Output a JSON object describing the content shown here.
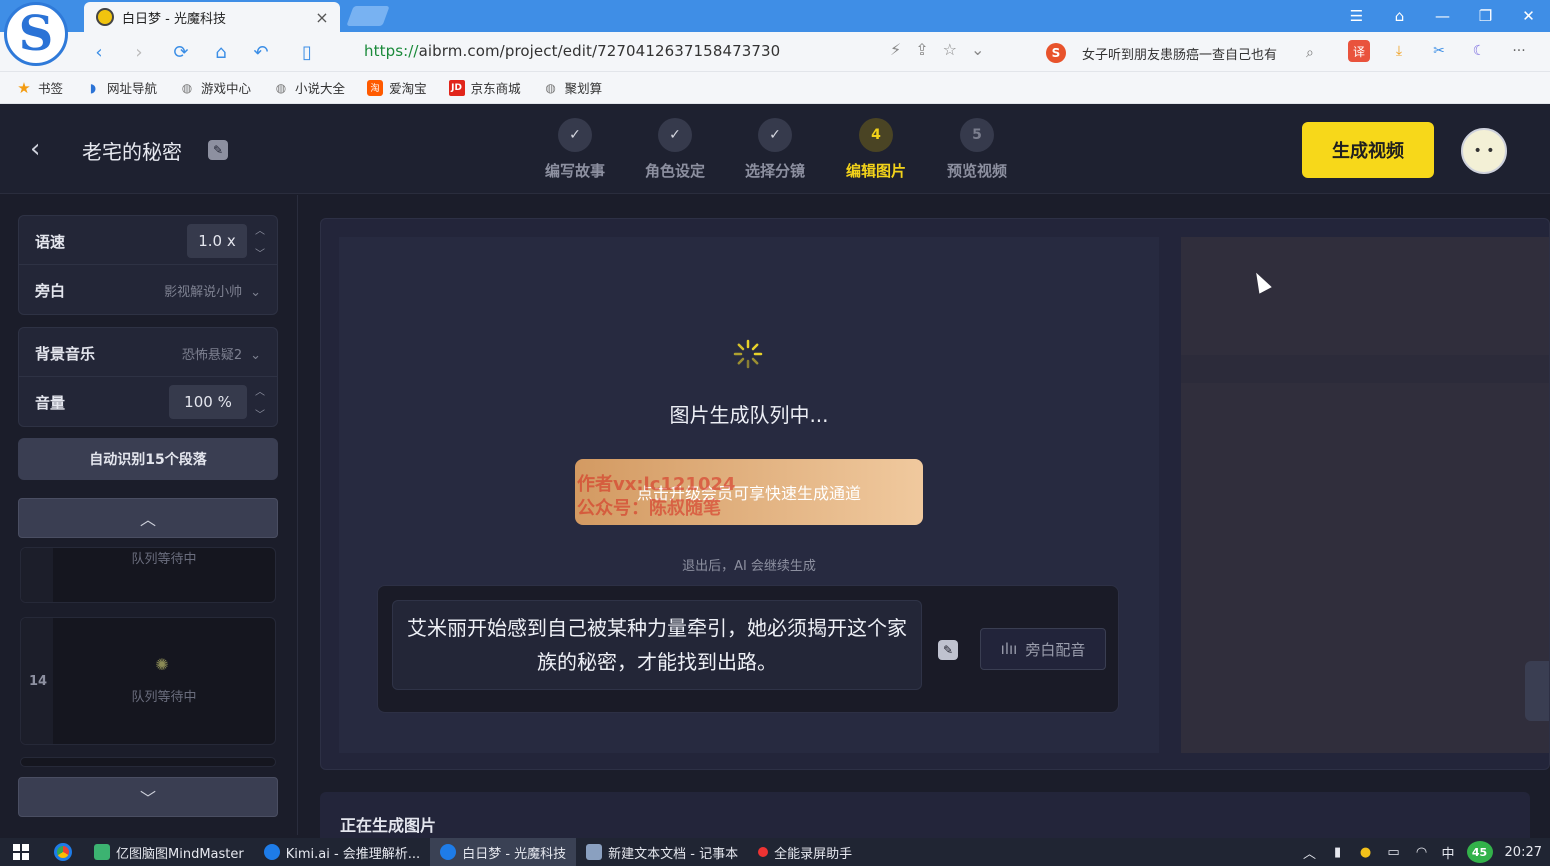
{
  "browser": {
    "tab_title": "白日梦 - 光魔科技",
    "tab_close": "×",
    "url_scheme": "https://",
    "url_rest": "aibrm.com/project/edit/7270412637158473730",
    "search_text": "女子听到朋友患肠癌一查自己也有",
    "search_engine": "S",
    "translate_label": "译",
    "bookmarks": [
      {
        "label": "书签",
        "icon": "star-icon"
      },
      {
        "label": "网址导航",
        "icon": "nav-icon"
      },
      {
        "label": "游戏中心",
        "icon": "globe-icon"
      },
      {
        "label": "小说大全",
        "icon": "globe-icon"
      },
      {
        "label": "爱淘宝",
        "icon": "taobao-icon",
        "badge": "淘"
      },
      {
        "label": "京东商城",
        "icon": "jd-icon",
        "badge": "JD"
      },
      {
        "label": "聚划算",
        "icon": "globe-icon"
      }
    ]
  },
  "header": {
    "project_title": "老宅的秘密",
    "steps": [
      {
        "number": "✓",
        "label": "编写故事",
        "state": "done"
      },
      {
        "number": "✓",
        "label": "角色设定",
        "state": "done"
      },
      {
        "number": "✓",
        "label": "选择分镜",
        "state": "done"
      },
      {
        "number": "4",
        "label": "编辑图片",
        "state": "active"
      },
      {
        "number": "5",
        "label": "预览视频",
        "state": "todo"
      }
    ],
    "generate_button": "生成视频"
  },
  "sidebar": {
    "speed_label": "语速",
    "speed_value": "1.0 x",
    "narration_label": "旁白",
    "narration_value": "影视解说小帅",
    "bgm_label": "背景音乐",
    "bgm_value": "恐怖悬疑2",
    "volume_label": "音量",
    "volume_value": "100 %",
    "auto_detect_button": "自动识别15个段落",
    "segments": [
      {
        "number": "",
        "status": "队列等待中"
      },
      {
        "number": "14",
        "status": "队列等待中"
      }
    ]
  },
  "main": {
    "queue_title": "图片生成队列中...",
    "upgrade_button": "点击升级会员可享快速生成通道",
    "watermark_line1": "作者vx:lc121024",
    "watermark_line2": "公众号：陈叔随笔",
    "exit_hint": "退出后，AI 会继续生成",
    "caption_text": "艾米丽开始感到自己被某种力量牵引，她必须揭开这个家族的秘密，才能找到出路。",
    "voice_button": "旁白配音",
    "generating_title": "正在生成图片"
  },
  "taskbar": {
    "items": [
      {
        "label": "亿图脑图MindMaster",
        "color": "#3cb371"
      },
      {
        "label": "Kimi.ai - 会推理解析...",
        "color": "#1e7ce8"
      },
      {
        "label": "白日梦 - 光魔科技",
        "color": "#1e7ce8"
      },
      {
        "label": "新建文本文档 - 记事本",
        "color": "#8aa0c0"
      },
      {
        "label": "全能录屏助手",
        "color": "#e33"
      }
    ],
    "ime": "中",
    "badge": "45",
    "time": "20:27"
  },
  "colors": {
    "accent_yellow": "#f7d81a",
    "browser_blue": "#3f8ee6",
    "app_bg": "#1b1d2a"
  }
}
